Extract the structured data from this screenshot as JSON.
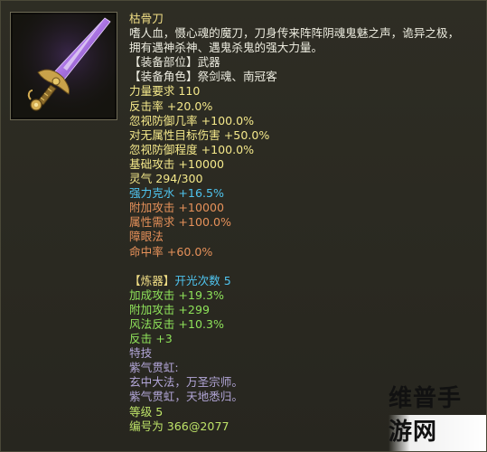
{
  "item": {
    "name": "枯骨刀",
    "desc1": "嗜人血，慑心魂的魔刀，刀身传来阵阵阴魂鬼魅之声，诡异之极，",
    "desc2": "拥有遇神杀神、遇鬼杀鬼的强大力量。",
    "slot": "【装备部位】武器",
    "roles": "【装备角色】祭剑魂、南冠客",
    "strength_req": "力量要求 110",
    "counter_rate": "反击率 +20.0%",
    "ignore_def_chance": "忽视防御几率 +100.0%",
    "non_attr_damage": "对无属性目标伤害 +50.0%",
    "ignore_def_degree": "忽视防御程度 +100.0%",
    "base_attack": "基础攻击 +10000",
    "spirit": "灵气 294/300",
    "water_bonus": "强力克水 +16.5%",
    "extra_attack_1": "附加攻击 +10000",
    "attr_req": "属性需求 +100.0%",
    "blind": "障眼法",
    "hit_rate": "命中率 +60.0%",
    "refine_label": "【炼器】",
    "refine_count": "开光次数 5",
    "boost_attack": "加成攻击 +19.3%",
    "extra_attack_2": "附加攻击 +299",
    "wind_counter": "风法反击 +10.3%",
    "counter": "反击 +3",
    "skill_title": "特技",
    "skill_name": "紫气贯虹:",
    "skill_line1": "玄中大法，万圣宗师。",
    "skill_line2": "紫气贯虹，天地悉归。",
    "level": "等级 5",
    "serial": "编号为 366@2077"
  },
  "watermark": {
    "text": "维普手游网"
  },
  "icon": "sword-icon",
  "colors": {
    "gold": "#f2df86",
    "white": "#ecebdf",
    "blue": "#4fc4ef",
    "orange": "#e6915a",
    "green": "#8fe35a",
    "purple": "#b3a7d9"
  }
}
